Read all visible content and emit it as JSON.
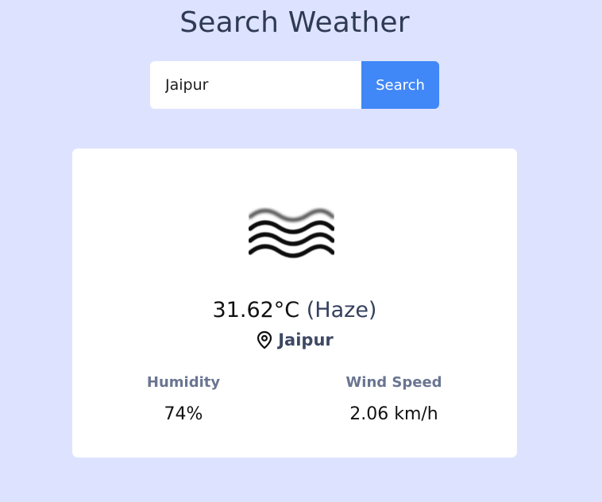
{
  "page": {
    "title": "Search Weather"
  },
  "search": {
    "value": "Jaipur",
    "button_label": "Search"
  },
  "weather": {
    "icon": "haze-icon",
    "temperature": "31.62°C",
    "condition": "(Haze)",
    "location_icon": "map-pin-icon",
    "location": "Jaipur",
    "humidity_label": "Humidity",
    "humidity_value": "74%",
    "wind_label": "Wind Speed",
    "wind_value": "2.06 km/h"
  },
  "colors": {
    "background": "#dde3ff",
    "accent": "#4087f7",
    "card": "#ffffff"
  }
}
